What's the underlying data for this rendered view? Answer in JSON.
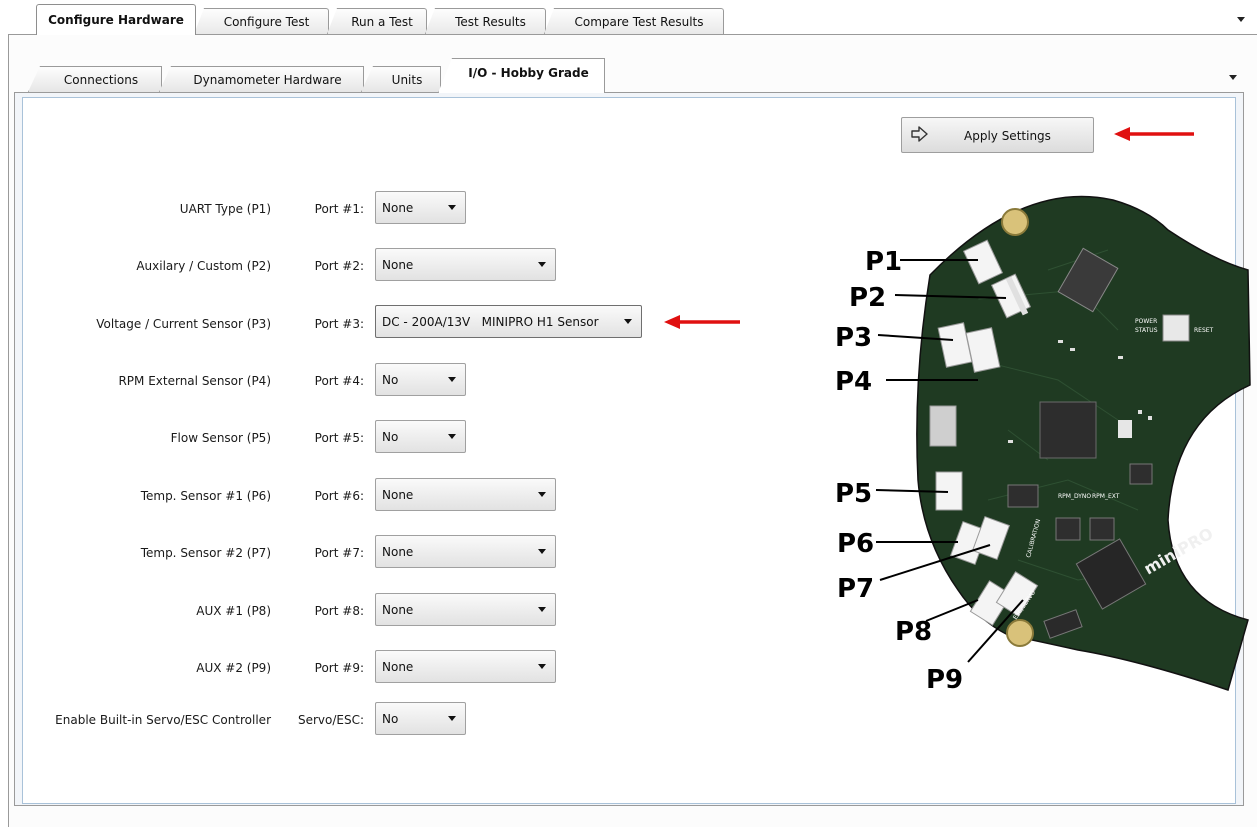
{
  "main_tabs": [
    "Configure Hardware",
    "Configure Test",
    "Run a Test",
    "Test Results",
    "Compare Test Results"
  ],
  "sub_tabs": [
    "Connections",
    "Dynamometer Hardware",
    "Units",
    "I/O - Hobby Grade"
  ],
  "apply_label": "Apply Settings",
  "rows": [
    {
      "label": "UART Type (P1)",
      "port": "Port #1:",
      "value": "None"
    },
    {
      "label": "Auxilary / Custom (P2)",
      "port": "Port #2:",
      "value": "None"
    },
    {
      "label": "Voltage / Current Sensor (P3)",
      "port": "Port #3:",
      "value": "DC - 200A/13V   MINIPRO H1 Sensor"
    },
    {
      "label": "RPM External Sensor (P4)",
      "port": "Port #4:",
      "value": "No"
    },
    {
      "label": "Flow Sensor (P5)",
      "port": "Port #5:",
      "value": "No"
    },
    {
      "label": "Temp. Sensor #1 (P6)",
      "port": "Port #6:",
      "value": "None"
    },
    {
      "label": "Temp. Sensor #2 (P7)",
      "port": "Port #7:",
      "value": "None"
    },
    {
      "label": "AUX #1 (P8)",
      "port": "Port #8:",
      "value": "None"
    },
    {
      "label": "AUX #2 (P9)",
      "port": "Port #9:",
      "value": "None"
    },
    {
      "label": "Enable Built-in Servo/ESC Controller",
      "port": "Servo/ESC:",
      "value": "No"
    }
  ],
  "board": {
    "callouts": [
      "P1",
      "P2",
      "P3",
      "P4",
      "P5",
      "P6",
      "P7",
      "P8",
      "P9"
    ],
    "silk": {
      "reset": "RESET",
      "power": "POWER",
      "status": "STATUS",
      "rpm_dyno": "RPM_DYNO",
      "rpm_ext": "RPM_EXT",
      "calibration": "CALIBRATION",
      "esc_servo": "ESC/SERVO",
      "logo": "miniPRO"
    }
  },
  "colors": {
    "pcb": "#1f3a22",
    "annotation_arrow": "#e01010",
    "panel_border": "#a9c2d9"
  }
}
